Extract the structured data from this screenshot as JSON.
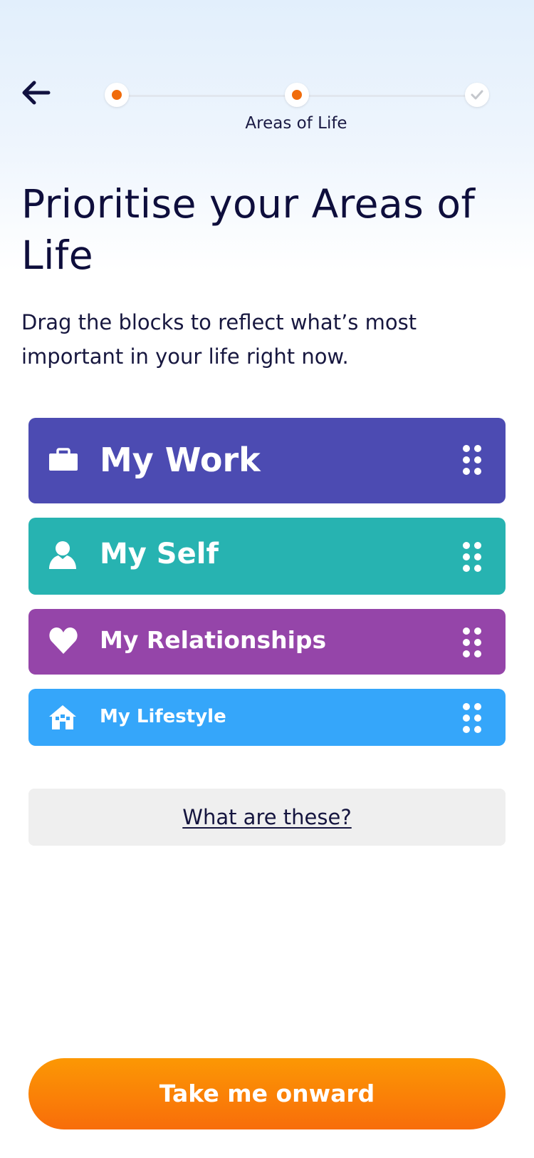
{
  "header": {
    "back_icon": "arrow-left-icon",
    "step_label": "Areas of Life",
    "steps": [
      {
        "state": "current",
        "color": "#f06c0c"
      },
      {
        "state": "current",
        "color": "#f06c0c"
      },
      {
        "state": "complete",
        "icon": "check-icon"
      }
    ]
  },
  "page": {
    "title": "Prioritise your Areas of Life",
    "subtitle": "Drag the blocks to reflect what’s most important in your life right now."
  },
  "areas": [
    {
      "label": "My Work",
      "icon": "briefcase-icon",
      "color": "#4c4bb2"
    },
    {
      "label": "My Self",
      "icon": "person-icon",
      "color": "#27b3b1"
    },
    {
      "label": "My Relationships",
      "icon": "heart-icon",
      "color": "#9545a9"
    },
    {
      "label": "My Lifestyle",
      "icon": "house-icon",
      "color": "#35a6fa"
    }
  ],
  "info_link": "What are these?",
  "cta": {
    "label": "Take me onward",
    "color": "#f86d0a"
  }
}
